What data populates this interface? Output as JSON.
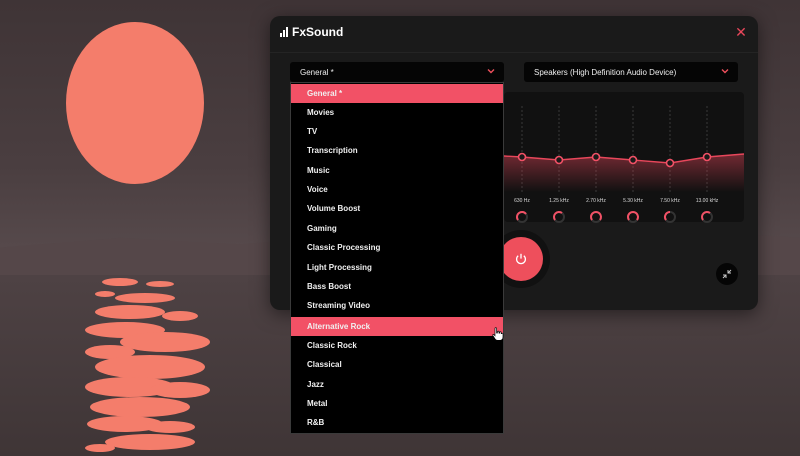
{
  "app": {
    "title": "FxSound",
    "close_icon": "close-icon",
    "accent": "#f25166"
  },
  "preset_select": {
    "value": "General *"
  },
  "device_select": {
    "value": "Speakers (High Definition Audio Device)"
  },
  "eq": {
    "bands": [
      {
        "label": "630 Hz"
      },
      {
        "label": "1.25 kHz"
      },
      {
        "label": "2.70 kHz"
      },
      {
        "label": "5.30 kHz"
      },
      {
        "label": "7.50 kHz"
      },
      {
        "label": "13.00 kHz"
      }
    ]
  },
  "dropdown": {
    "items": [
      {
        "label": "General *",
        "highlighted": true
      },
      {
        "label": "Movies"
      },
      {
        "label": "TV"
      },
      {
        "label": "Transcription"
      },
      {
        "label": "Music"
      },
      {
        "label": "Voice"
      },
      {
        "label": "Volume Boost"
      },
      {
        "label": "Gaming"
      },
      {
        "label": "Classic Processing"
      },
      {
        "label": "Light Processing"
      },
      {
        "label": "Bass Boost"
      },
      {
        "label": "Streaming Video"
      },
      {
        "label": "Alternative Rock",
        "highlighted": true
      },
      {
        "label": "Classic Rock"
      },
      {
        "label": "Classical"
      },
      {
        "label": "Jazz"
      },
      {
        "label": "Metal"
      },
      {
        "label": "R&B"
      }
    ]
  },
  "icons": {
    "power": "power-icon",
    "shrink": "shrink-icon",
    "cursor": "hand-cursor-icon"
  }
}
